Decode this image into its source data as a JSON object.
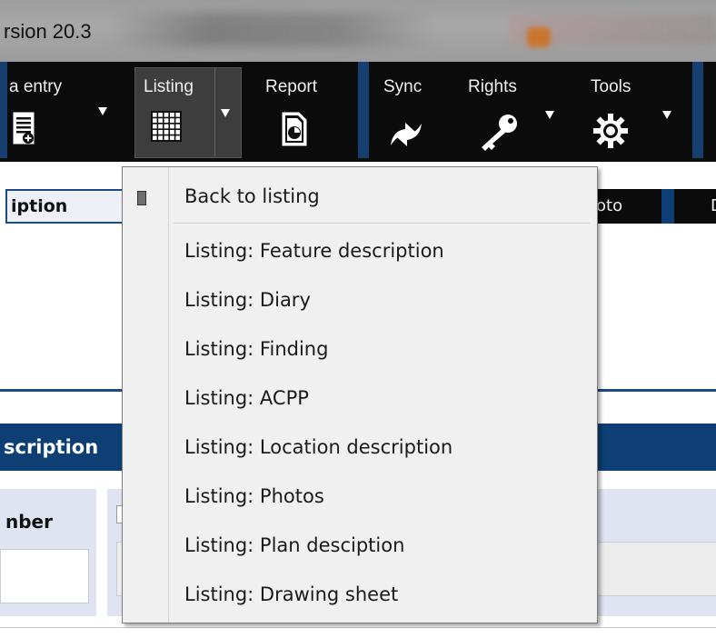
{
  "window": {
    "title": "rsion 20.3"
  },
  "toolbar": {
    "data_entry": {
      "label": "a entry",
      "icon": "document-add-icon"
    },
    "listing": {
      "label": "Listing",
      "icon": "grid-icon"
    },
    "report": {
      "label": "Report",
      "icon": "report-document-icon"
    },
    "sync": {
      "label": "Sync",
      "icon": "sync-arrows-icon"
    },
    "rights": {
      "label": "Rights",
      "icon": "key-icon"
    },
    "tools": {
      "label": "Tools",
      "icon": "gear-icon"
    }
  },
  "tabs": {
    "description": "iption",
    "photo": "oto",
    "d": "D"
  },
  "section": {
    "title": "scription"
  },
  "form": {
    "number_label": "nber"
  },
  "menu": {
    "items": [
      "Back to listing",
      "Listing: Feature description",
      "Listing: Diary",
      "Listing: Finding",
      "Listing: ACPP",
      "Listing: Location description",
      "Listing: Photos",
      "Listing: Plan desciption",
      "Listing: Drawing sheet"
    ]
  },
  "colors": {
    "toolbar_bg": "#0b0b0b",
    "accent_blue": "#0d3f74",
    "menu_bg": "#f0f0f0"
  }
}
